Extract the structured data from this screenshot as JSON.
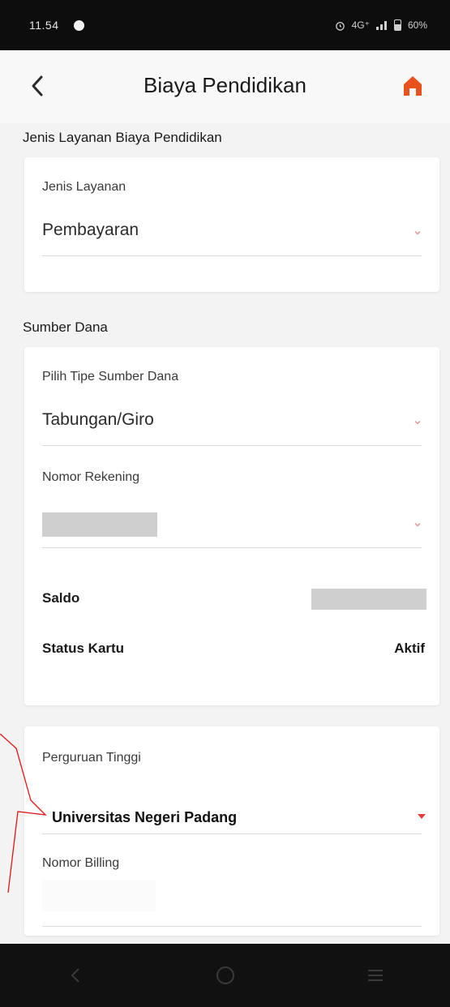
{
  "status_bar": {
    "time": "11.54",
    "signal_text": "4G⁺",
    "battery": "60%"
  },
  "header": {
    "title": "Biaya Pendidikan",
    "back_icon": "chevron-left-icon",
    "home_icon": "home-icon",
    "accent_color": "#e8501c"
  },
  "sections": {
    "jenis_layanan_section": "Jenis Layanan Biaya Pendidikan",
    "sumber_dana_section": "Sumber Dana"
  },
  "jenis_layanan": {
    "label": "Jenis Layanan",
    "value": "Pembayaran"
  },
  "sumber_dana": {
    "tipe_label": "Pilih Tipe Sumber Dana",
    "tipe_value": "Tabungan/Giro",
    "rekening_label": "Nomor Rekening",
    "saldo_label": "Saldo",
    "status_label": "Status Kartu",
    "status_value": "Aktif"
  },
  "institusi": {
    "pt_label": "Perguruan Tinggi",
    "pt_value": "Universitas Negeri Padang",
    "billing_label": "Nomor Billing"
  },
  "colors": {
    "chevron": "#e23b3b",
    "chevron_light": "#e8a0a0"
  }
}
